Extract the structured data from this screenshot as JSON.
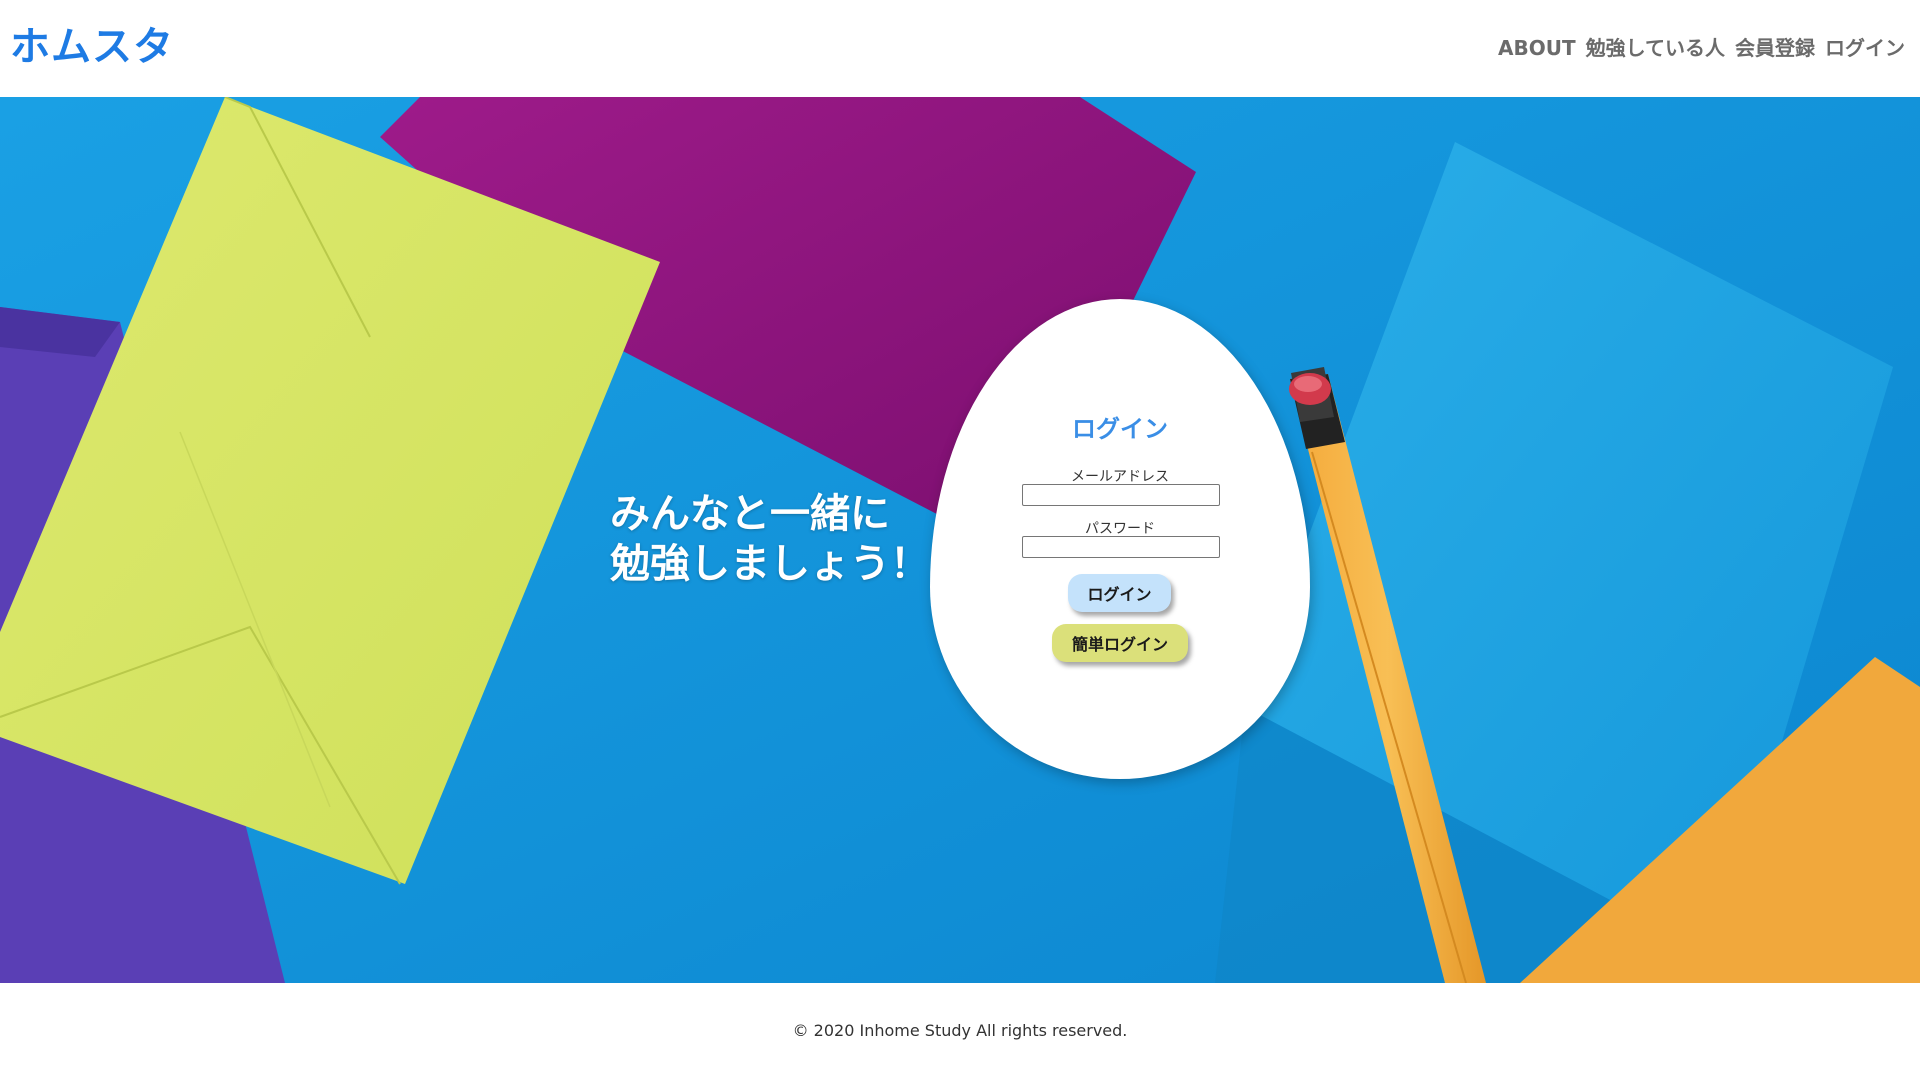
{
  "header": {
    "logo": "ホムスタ",
    "nav": {
      "about": "ABOUT",
      "studying": "勉強している人",
      "signup": "会員登録",
      "login": "ログイン"
    }
  },
  "hero": {
    "tagline_line1": "みんなと一緒に",
    "tagline_line2": "勉強しましょう！"
  },
  "login_form": {
    "title": "ログイン",
    "email_label": "メールアドレス",
    "email_value": "",
    "password_label": "パスワード",
    "password_value": "",
    "login_button": "ログイン",
    "easy_login_button": "簡単ログイン"
  },
  "footer": {
    "copyright": "© 2020 Inhome Study All rights reserved."
  },
  "colors": {
    "brand": "#1e7be4",
    "nav_text": "#6b6b6b",
    "login_button": "#c4e2fb",
    "easy_login_button": "#dbe07a"
  }
}
